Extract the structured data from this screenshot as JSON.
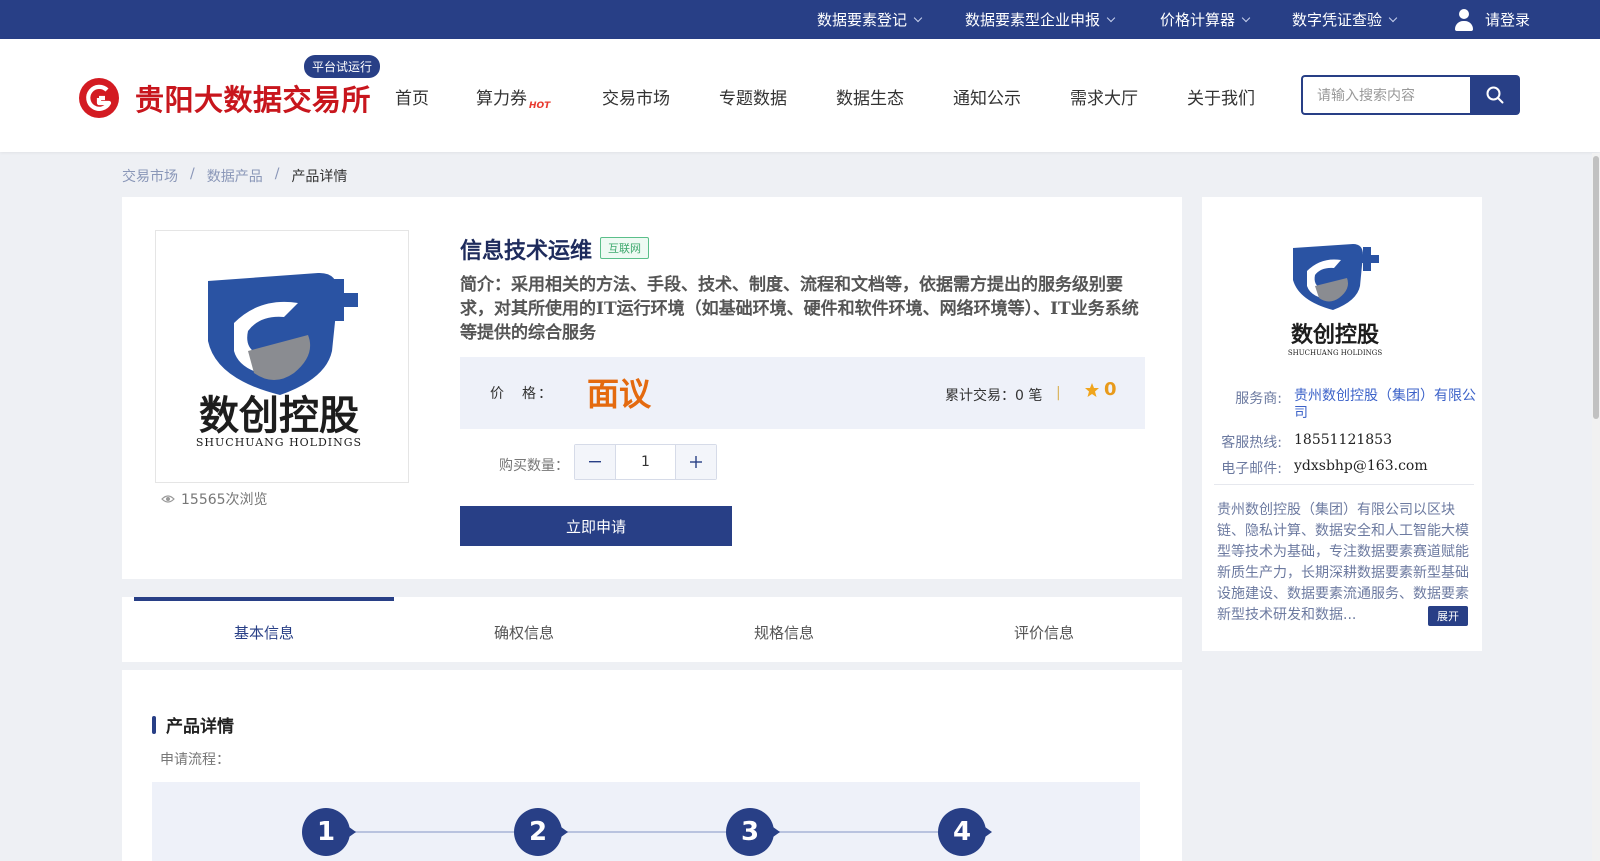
{
  "topbar": {
    "items": [
      {
        "label": "数据要素登记"
      },
      {
        "label": "数据要素型企业申报"
      },
      {
        "label": "价格计算器"
      },
      {
        "label": "数字凭证查验"
      }
    ],
    "login_label": "请登录"
  },
  "header": {
    "brand": "贵阳大数据交易所",
    "trial_badge": "平台试运行",
    "nav": [
      "首页",
      "算力券",
      "交易市场",
      "专题数据",
      "数据生态",
      "通知公示",
      "需求大厅",
      "关于我们"
    ],
    "hot_badge": "HOT",
    "search_placeholder": "请输入搜索内容"
  },
  "breadcrumb": {
    "items": [
      "交易市场",
      "数据产品",
      "产品详情"
    ],
    "separator": "/"
  },
  "product": {
    "logo_text_cn": "数创控股",
    "logo_text_en": "SHUCHUANG HOLDINGS",
    "views": "15565次浏览",
    "title": "信息技术运维",
    "tag": "互联网",
    "description": "简介：采用相关的方法、手段、技术、制度、流程和文档等，依据需方提出的服务级别要求，对其所使用的IT运行环境（如基础环境、硬件和软件环境、网络环境等）、IT业务系统等提供的综合服务",
    "price_label": "价　格：",
    "price_value": "面议",
    "trades": "累计交易：0 笔",
    "rating": "0",
    "qty_label": "购买数量：",
    "qty_value": "1",
    "apply_label": "立即申请"
  },
  "tabs": [
    {
      "label": "基本信息",
      "active": true
    },
    {
      "label": "确权信息",
      "active": false
    },
    {
      "label": "规格信息",
      "active": false
    },
    {
      "label": "评价信息",
      "active": false
    }
  ],
  "details": {
    "heading": "产品详情",
    "flow_label": "申请流程：",
    "steps": [
      "1",
      "2",
      "3",
      "4"
    ]
  },
  "provider": {
    "logo_text_cn": "数创控股",
    "logo_text_en": "SHUCHUANG HOLDINGS",
    "provider_key": "服务商:",
    "provider_value": "贵州数创控股（集团）有限公司",
    "hotline_key": "客服热线:",
    "hotline_value": "18551121853",
    "email_key": "电子邮件:",
    "email_value": "ydxsbhp@163.com",
    "description": "贵州数创控股（集团）有限公司以区块链、隐私计算、数据安全和人工智能大模型等技术为基础，专注数据要素赛道赋能新质生产力，长期深耕数据要素新型基础设施建设、数据要素流通服务、数据要素新型技术研发和数据...",
    "expand_label": "展开"
  },
  "colors": {
    "primary": "#283f86",
    "brand_red": "#c8161d",
    "price_orange": "#e46a0f",
    "tag_green": "#3fa96e"
  }
}
